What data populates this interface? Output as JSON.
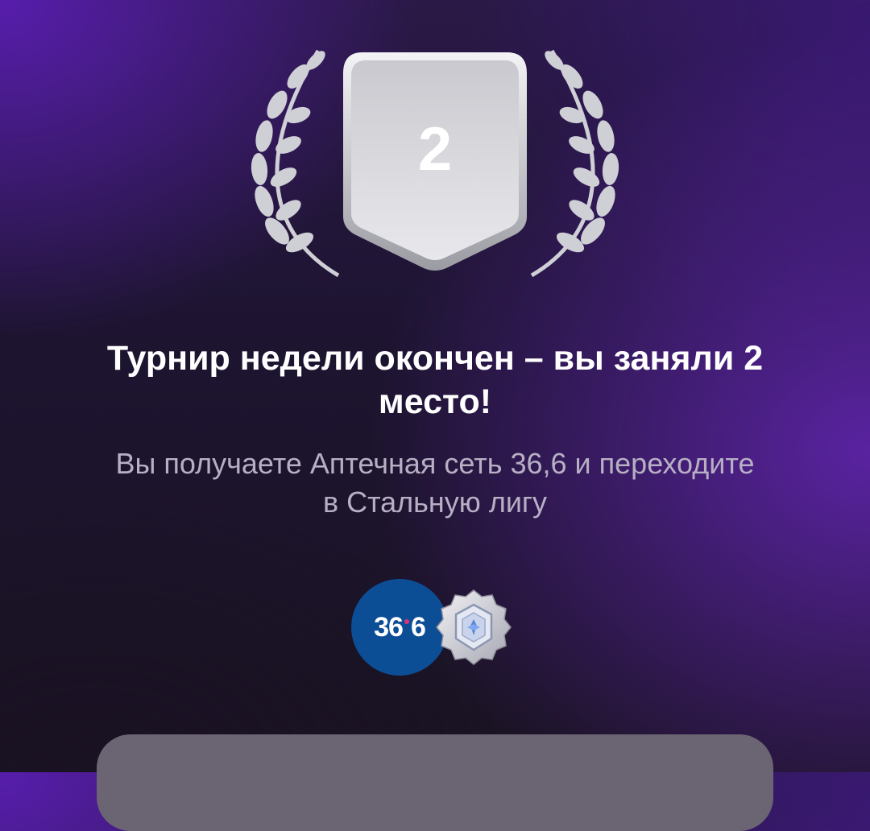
{
  "result": {
    "place_number": "2",
    "title": "Турнир недели окончен – вы заняли 2 место!",
    "subtitle": "Вы получаете Аптечная сеть 36,6 и переходите в Стальную лигу"
  },
  "rewards": {
    "partner_logo_left": "36",
    "partner_logo_right": "6",
    "league_icon": "steel-league-badge-icon"
  },
  "colors": {
    "background_accent": "#5a1fbe",
    "title_text": "#ffffff",
    "subtitle_text": "#b7afc4",
    "partner_logo_bg": "#0c4e96",
    "bottom_card": "#6b6472"
  }
}
